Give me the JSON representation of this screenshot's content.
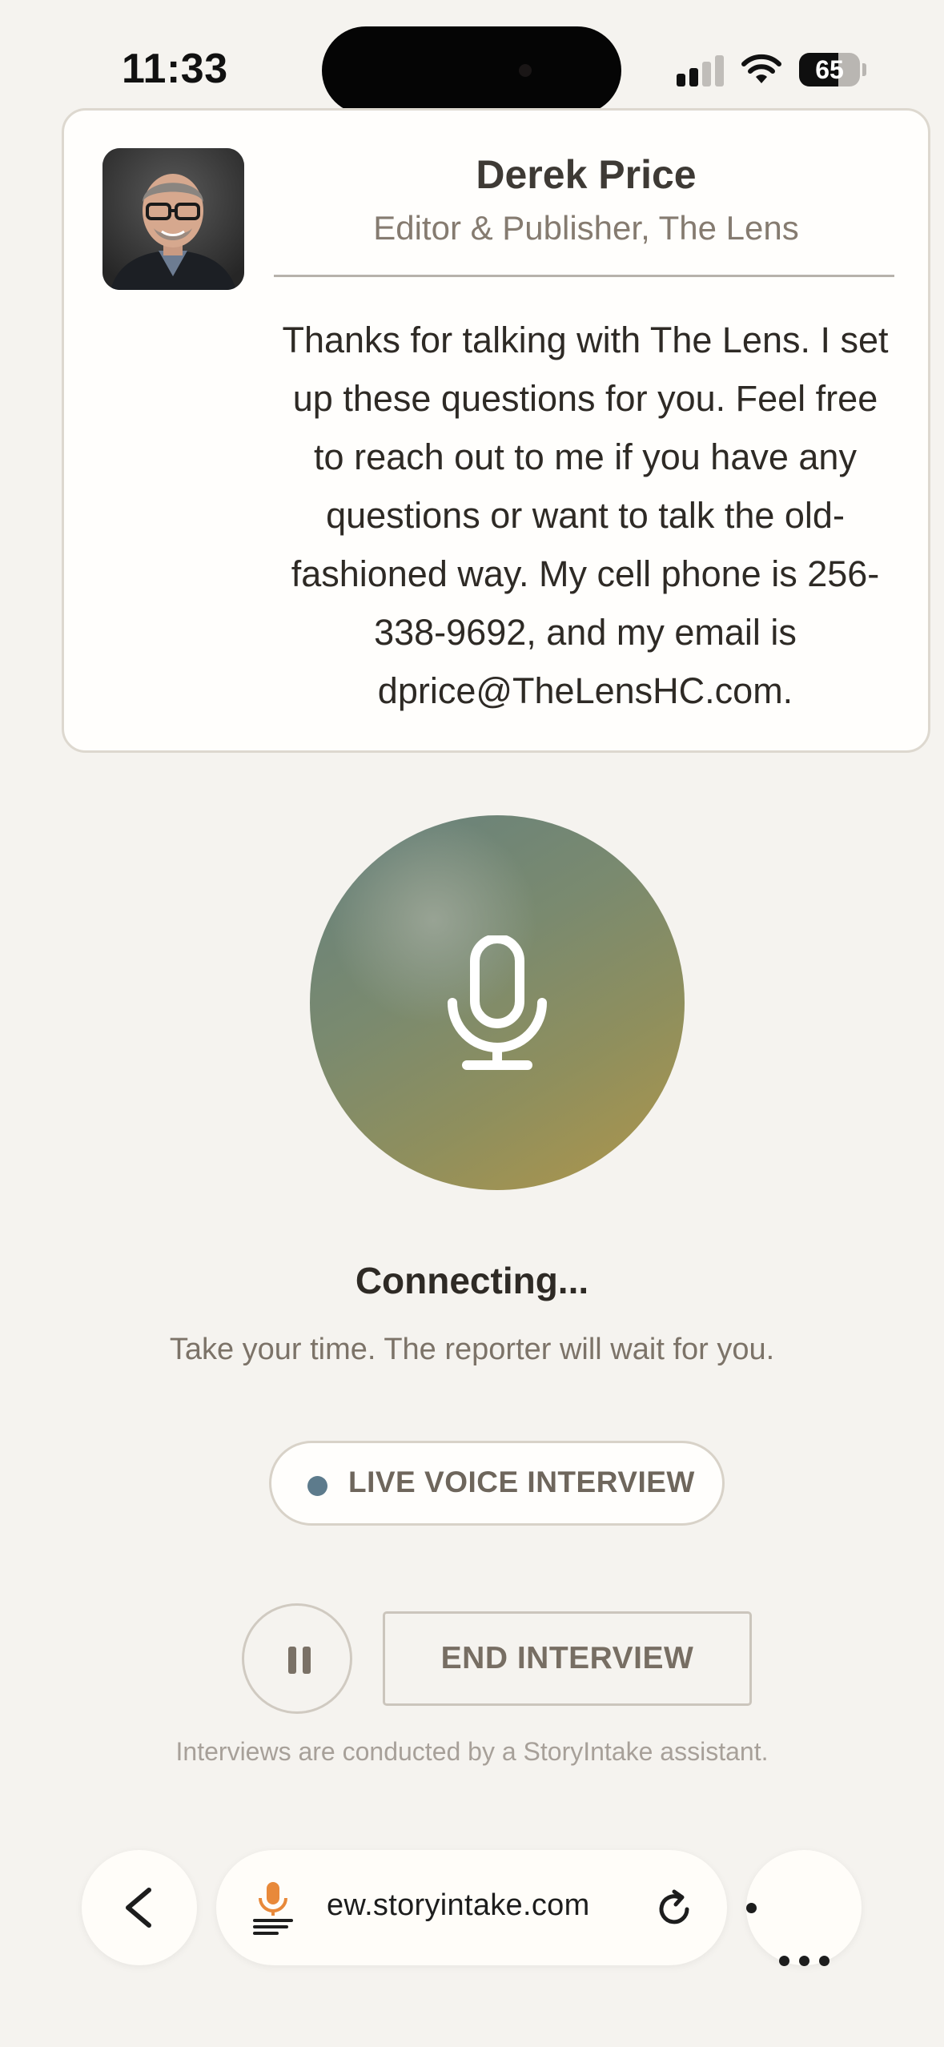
{
  "status_bar": {
    "time": "11:33",
    "battery_percent": "65",
    "battery_level": 0.65,
    "signal_bars_active": 2,
    "signal_bars_total": 4
  },
  "reporter_card": {
    "name": "Derek Price",
    "role": "Editor & Publisher, The Lens",
    "message": "Thanks for talking with The Lens. I set up these questions for you. Feel free to reach out to me if you have any questions or want to talk the old-fashioned way. My cell phone is 256-338-9692, and my email is dprice@TheLensHC.com."
  },
  "interview": {
    "mic_icon": "microphone-icon",
    "status_title": "Connecting...",
    "status_subtitle": "Take your time. The reporter will wait for you.",
    "mode_label": "LIVE VOICE INTERVIEW",
    "mode_dot_color": "#5d7b8c",
    "pause_icon": "pause-icon",
    "end_label": "END INTERVIEW",
    "footnote": "Interviews are conducted by a StoryIntake assistant."
  },
  "browser": {
    "back_icon": "chevron-left-icon",
    "site_icon": "microphone-lines-icon",
    "url": "ew.storyintake.com",
    "reload_icon": "reload-icon",
    "more_icon": "ellipsis-icon"
  },
  "colors": {
    "background": "#f5f3ef",
    "orb_start": "#65807e",
    "orb_end": "#b0964a",
    "site_icon_accent": "#e8893a"
  }
}
